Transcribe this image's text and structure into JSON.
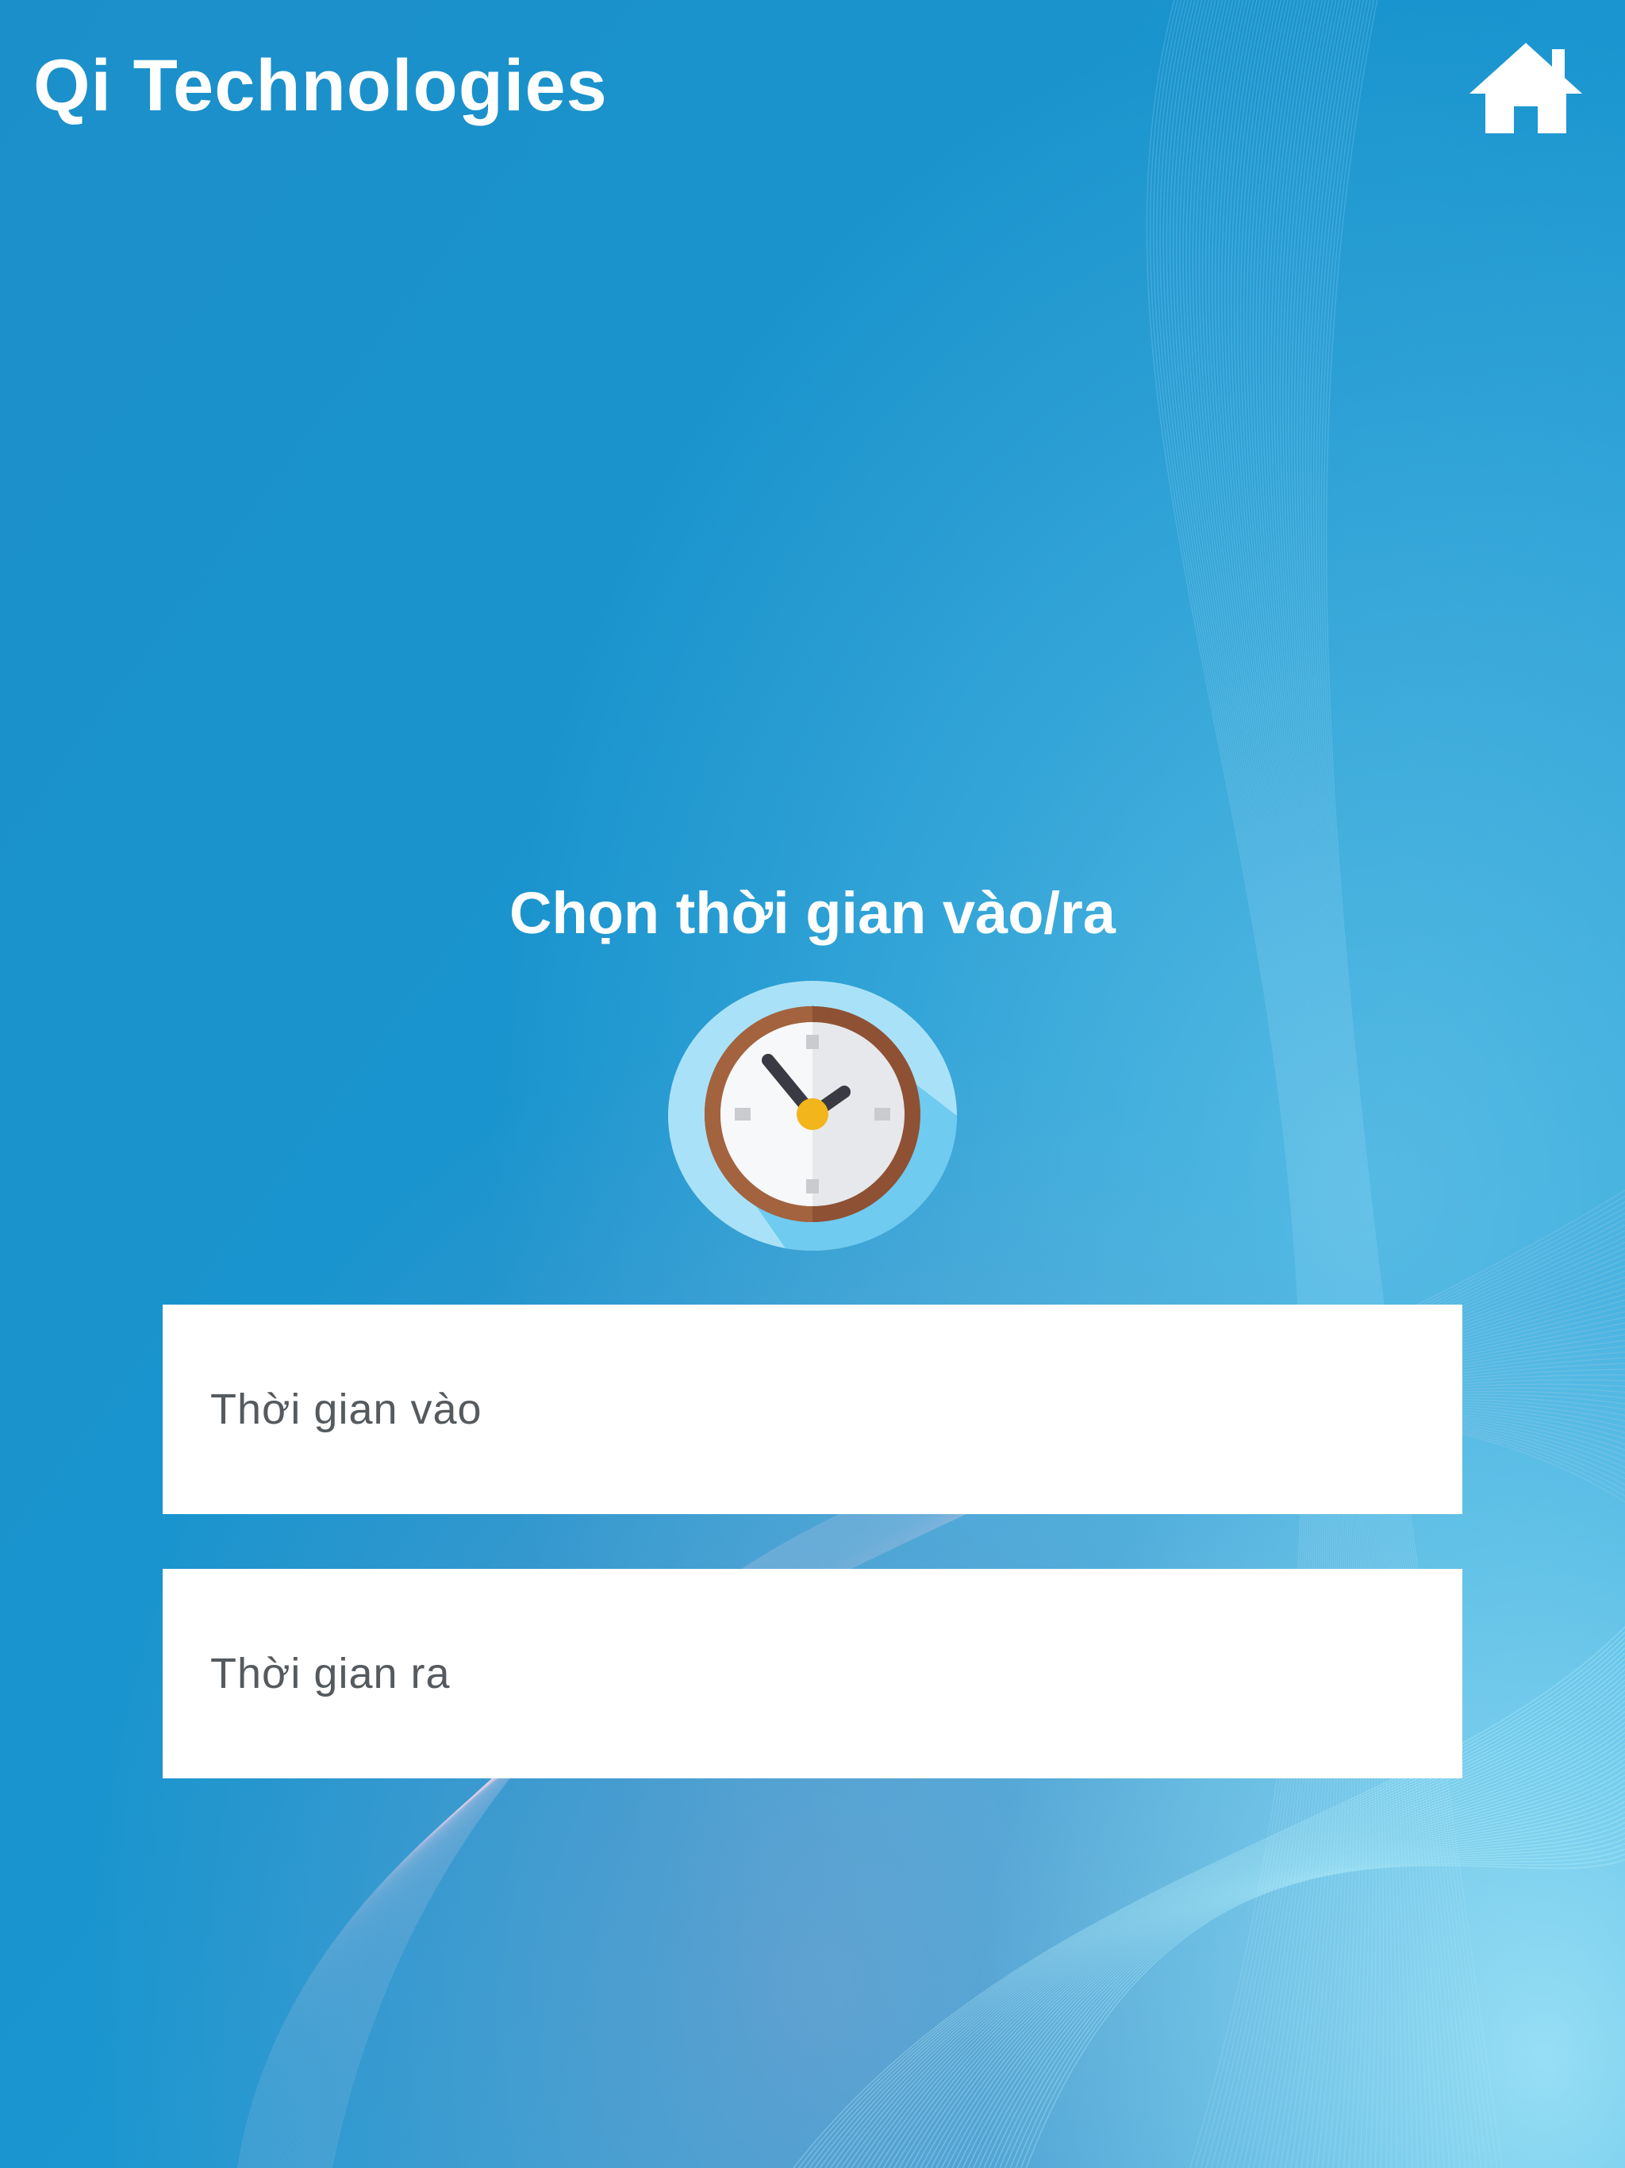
{
  "header": {
    "app_title": "Qi Technologies",
    "home_icon": "home-icon"
  },
  "main": {
    "title": "Chọn thời gian vào/ra",
    "clock_icon": "clock-icon",
    "fields": {
      "time_in_placeholder": "Thời gian vào",
      "time_out_placeholder": "Thời gian ra"
    }
  },
  "colors": {
    "background": "#1a93cc",
    "field_background": "#ffffff",
    "text_white": "#ffffff",
    "placeholder_text": "#555a5e"
  }
}
